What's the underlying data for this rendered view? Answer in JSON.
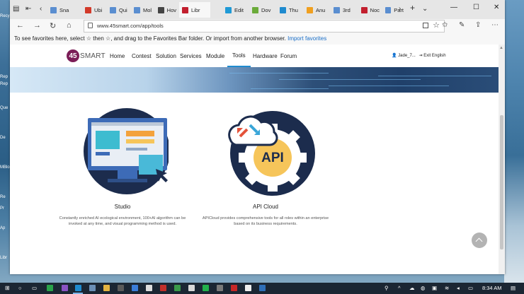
{
  "browser": {
    "tabs": [
      {
        "label": "Sna",
        "color": "#5a8ed0"
      },
      {
        "label": "Ubi",
        "color": "#d23a2a"
      },
      {
        "label": "Qui",
        "color": "#5a8ed0"
      },
      {
        "label": "Mol",
        "color": "#5a8ed0"
      },
      {
        "label": "Hov",
        "color": "#444444"
      },
      {
        "label": "Libr",
        "color": "#c21f2e"
      },
      {
        "label": "Edit",
        "color": "#1f9ad6"
      },
      {
        "label": "Dov",
        "color": "#6bab3a"
      },
      {
        "label": "Thu",
        "color": "#1f8bcf"
      },
      {
        "label": "Anu",
        "color": "#f0a020"
      },
      {
        "label": "3rd",
        "color": "#5a8ed0"
      },
      {
        "label": "Noc",
        "color": "#c21f2e"
      },
      {
        "label": "Part",
        "color": "#5a8ed0"
      }
    ],
    "url": "www.45smart.com/app/tools",
    "favorites_hint": "To see favorites here, select  ☆  then ☆, and drag to the Favorites Bar folder. Or import from another browser.",
    "import_link": "Import favorites"
  },
  "site": {
    "logo_number": "45",
    "logo_text": "SMART",
    "nav": [
      "Home",
      "Contest",
      "Solution",
      "Services",
      "Module",
      "Tools",
      "Hardware",
      "Forum"
    ],
    "active_nav": "Tools",
    "user": "Jade_7...",
    "exit": "Exit",
    "language": "English"
  },
  "cards": [
    {
      "title": "Studio",
      "desc": "Constantly enriched AI ecological environment, 100+AI algorithm can be invoked at any time, and visual programming method is used."
    },
    {
      "title": "API Cloud",
      "desc": "APICloud provides comprehensive tools for all roles within an enterprise based on its business requirements."
    }
  ],
  "api_label": "API",
  "desktop": [
    "Recyc",
    "Rep",
    "Rep",
    "Que",
    "De",
    "MBlo",
    "Re",
    "Pr",
    "Ap",
    "Libr"
  ],
  "taskbar": {
    "time": "8:34 AM"
  }
}
